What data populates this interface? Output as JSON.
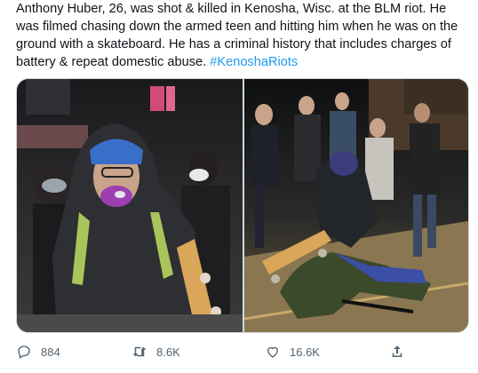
{
  "tweet": {
    "text": "Anthony Huber, 26, was shot & killed in Kenosha, Wisc. at the BLM riot. He was filmed chasing down the armed teen and hitting him when he was on the ground with a skateboard. He has a criminal history that includes charges of battery & repeat domestic abuse.",
    "hashtag": "#KenoshaRiots"
  },
  "actions": {
    "reply_count": "884",
    "retweet_count": "8.6K",
    "like_count": "16.6K"
  },
  "colors": {
    "text": "#0f1419",
    "link": "#1d9bf0",
    "icon": "#536471"
  },
  "icons": [
    "reply-icon",
    "retweet-icon",
    "like-icon",
    "share-icon"
  ]
}
